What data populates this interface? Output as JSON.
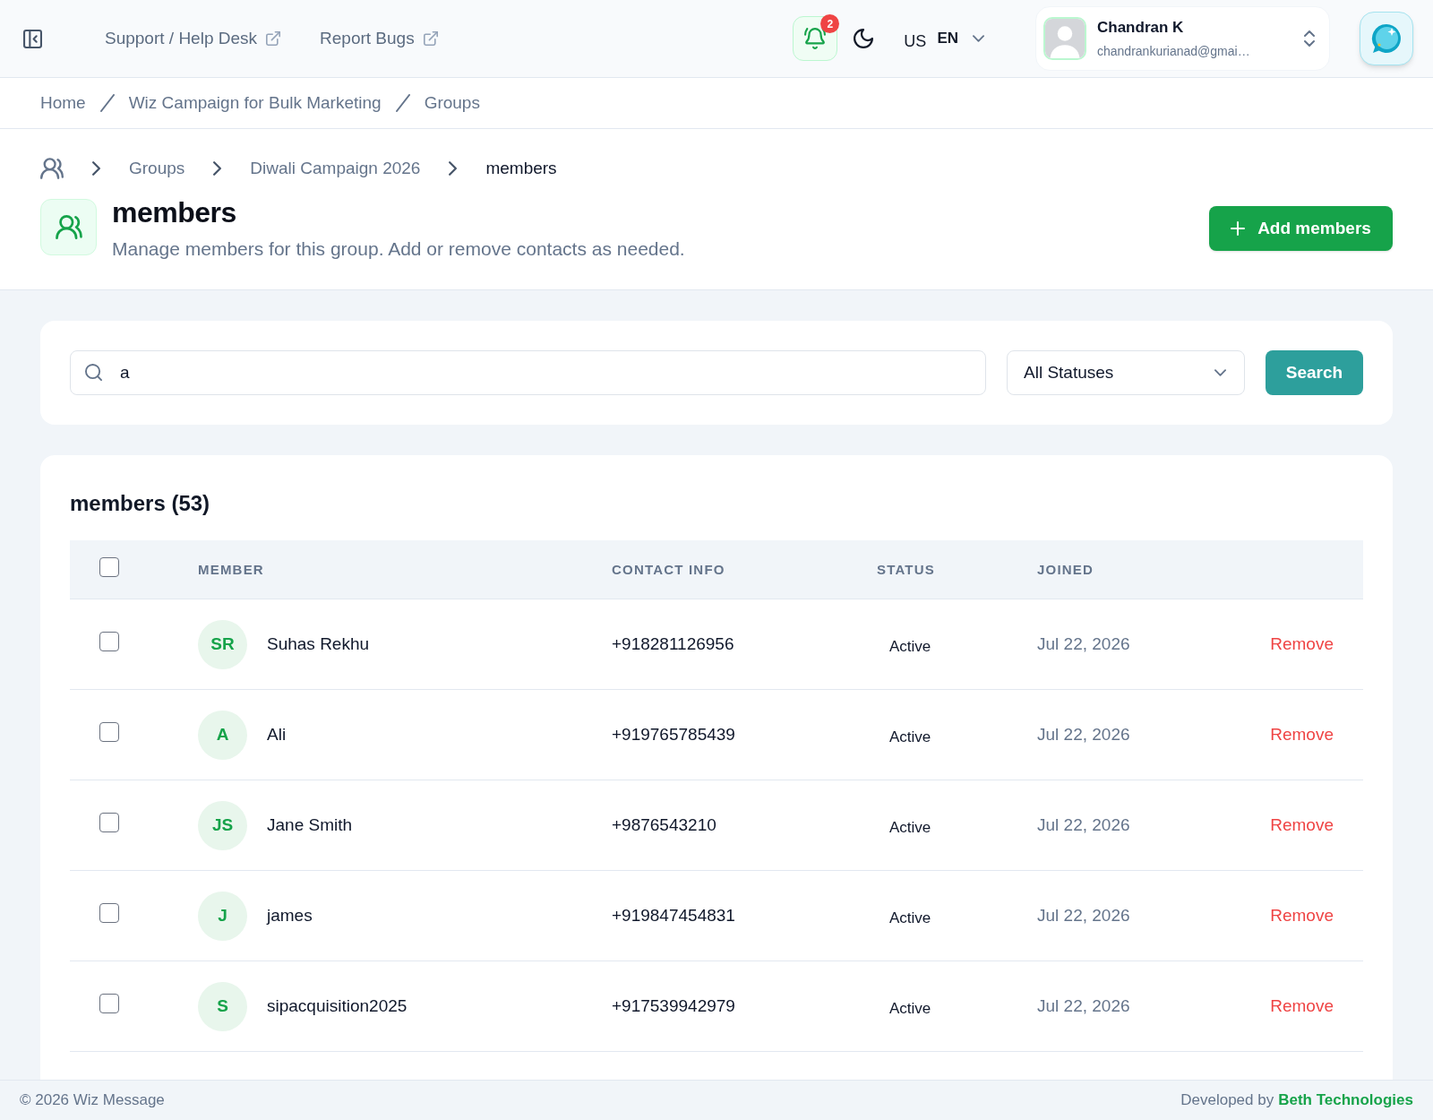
{
  "topbar": {
    "links": [
      {
        "label": "Support / Help Desk"
      },
      {
        "label": "Report Bugs"
      }
    ],
    "notifications": {
      "count": "2"
    },
    "locale": {
      "region": "US",
      "language": "EN"
    },
    "user": {
      "name": "Chandran K",
      "email": "chandrankurianad@gmai…"
    }
  },
  "breadcrumb": [
    {
      "label": "Home"
    },
    {
      "label": "Wiz Campaign for Bulk Marketing"
    },
    {
      "label": "Groups"
    }
  ],
  "page_header": {
    "path": [
      {
        "label": "Groups",
        "current": false
      },
      {
        "label": "Diwali Campaign 2026",
        "current": false
      },
      {
        "label": "members",
        "current": true
      }
    ],
    "title": "members",
    "subtitle": "Manage members for this group. Add or remove contacts as needed.",
    "add_button": {
      "label": "Add members"
    }
  },
  "filters": {
    "search": {
      "value": "a"
    },
    "status_select": {
      "value": "All Statuses"
    },
    "search_button": {
      "label": "Search"
    }
  },
  "members_table": {
    "title": "members (53)",
    "select_all": {
      "checked": false
    },
    "columns": [
      "MEMBER",
      "CONTACT INFO",
      "STATUS",
      "JOINED"
    ],
    "rows": [
      {
        "initials": "SR",
        "name": "Suhas Rekhu",
        "contact": "+918281126956",
        "status": "Active",
        "joined": "Jul 22, 2026",
        "action": "Remove",
        "checked": false
      },
      {
        "initials": "A",
        "name": "Ali",
        "contact": "+919765785439",
        "status": "Active",
        "joined": "Jul 22, 2026",
        "action": "Remove",
        "checked": false
      },
      {
        "initials": "JS",
        "name": "Jane Smith",
        "contact": "+9876543210",
        "status": "Active",
        "joined": "Jul 22, 2026",
        "action": "Remove",
        "checked": false
      },
      {
        "initials": "J",
        "name": "james",
        "contact": "+919847454831",
        "status": "Active",
        "joined": "Jul 22, 2026",
        "action": "Remove",
        "checked": false
      },
      {
        "initials": "S",
        "name": "sipacquisition2025",
        "contact": "+917539942979",
        "status": "Active",
        "joined": "Jul 22, 2026",
        "action": "Remove",
        "checked": false
      }
    ]
  },
  "footer": {
    "copyright": "© 2026 Wiz Message",
    "credit": "Developed by",
    "credit_link": "Beth Technologies"
  }
}
